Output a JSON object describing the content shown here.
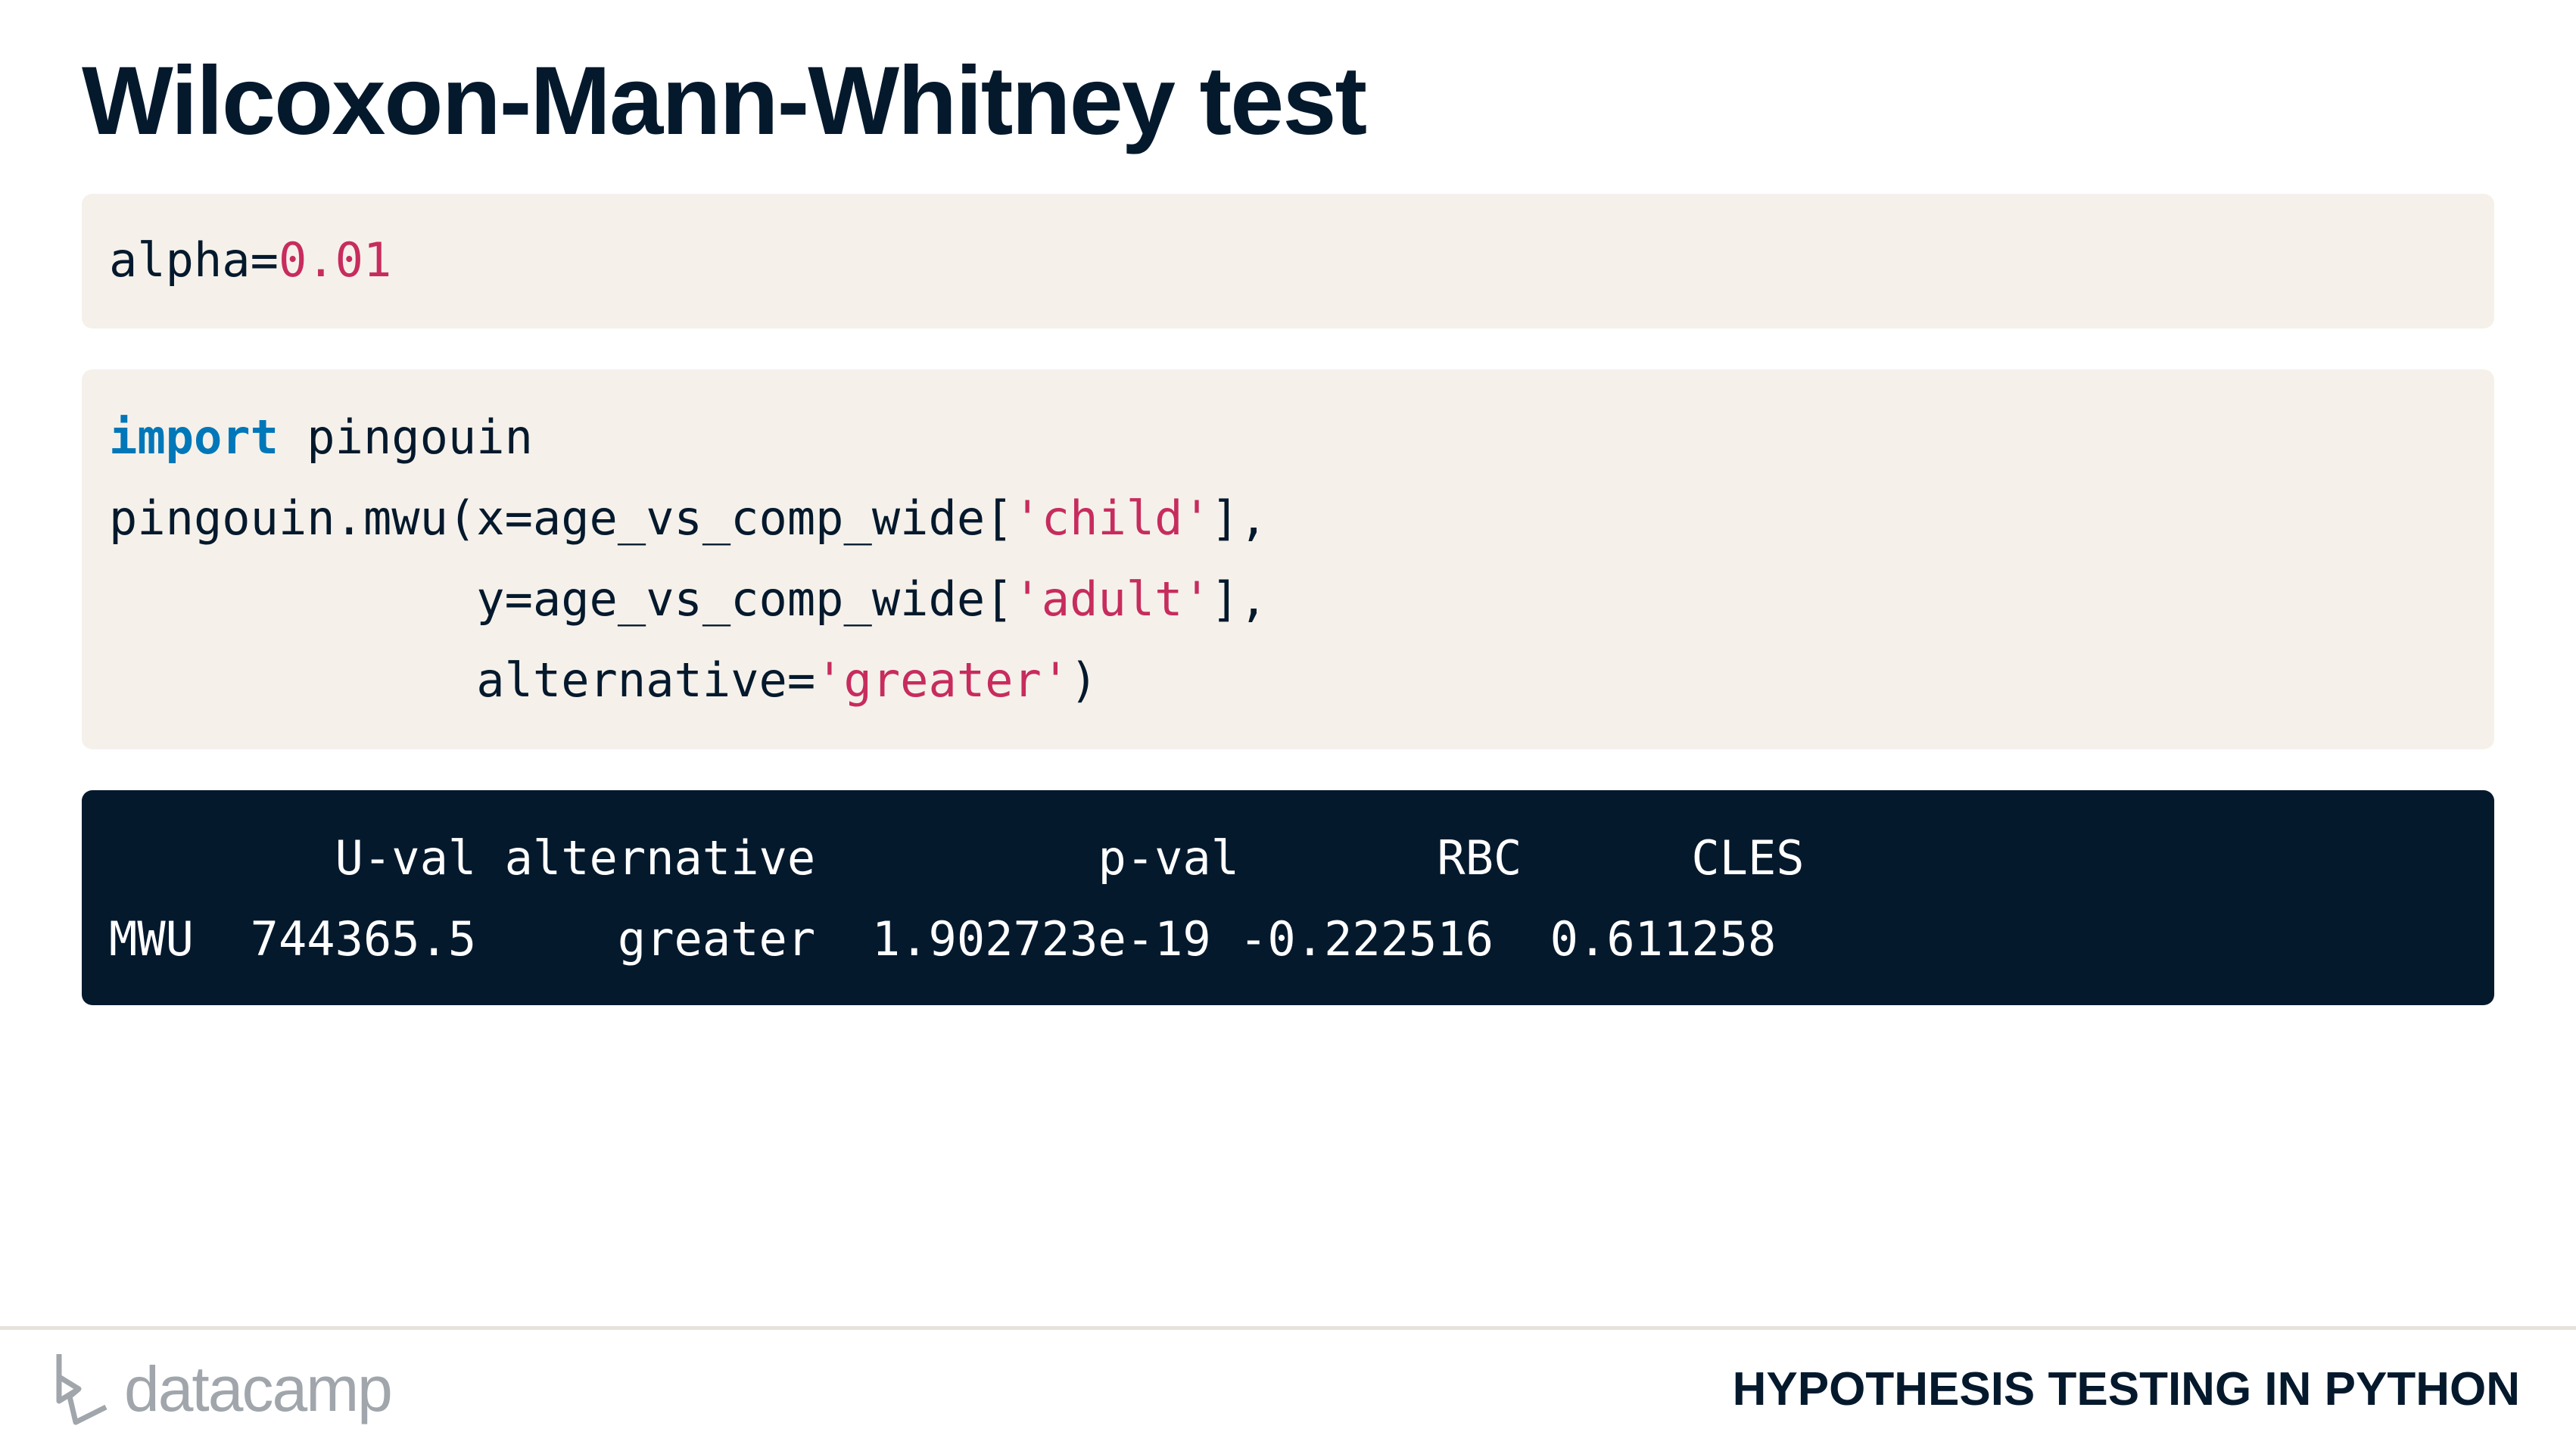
{
  "slide": {
    "title": "Wilcoxon-Mann-Whitney test"
  },
  "code_block_1": {
    "var": "alpha=",
    "value": "0.01"
  },
  "code_block_2": {
    "line1": {
      "keyword": "import",
      "rest": " pingouin"
    },
    "line2": {
      "pre": "pingouin.mwu(x=age_vs_comp_wide[",
      "str": "'child'",
      "post": "],"
    },
    "line3": {
      "pre": "             y=age_vs_comp_wide[",
      "str": "'adult'",
      "post": "],"
    },
    "line4": {
      "pre": "             alternative=",
      "str": "'greater'",
      "post": ")"
    }
  },
  "output": {
    "header": "        U-val alternative          p-val       RBC      CLES",
    "row": "MWU  744365.5     greater  1.902723e-19 -0.222516  0.611258",
    "columns": [
      "U-val",
      "alternative",
      "p-val",
      "RBC",
      "CLES"
    ],
    "rows": [
      {
        "index": "MWU",
        "U-val": "744365.5",
        "alternative": "greater",
        "p-val": "1.902723e-19",
        "RBC": "-0.222516",
        "CLES": "0.611258"
      }
    ]
  },
  "footer": {
    "logo_text": "datacamp",
    "course_title": "HYPOTHESIS TESTING IN PYTHON"
  },
  "colors": {
    "navy": "#05192d",
    "code_bg": "#f5f1ea",
    "keyword": "#0077b8",
    "string": "#c72c5e"
  }
}
